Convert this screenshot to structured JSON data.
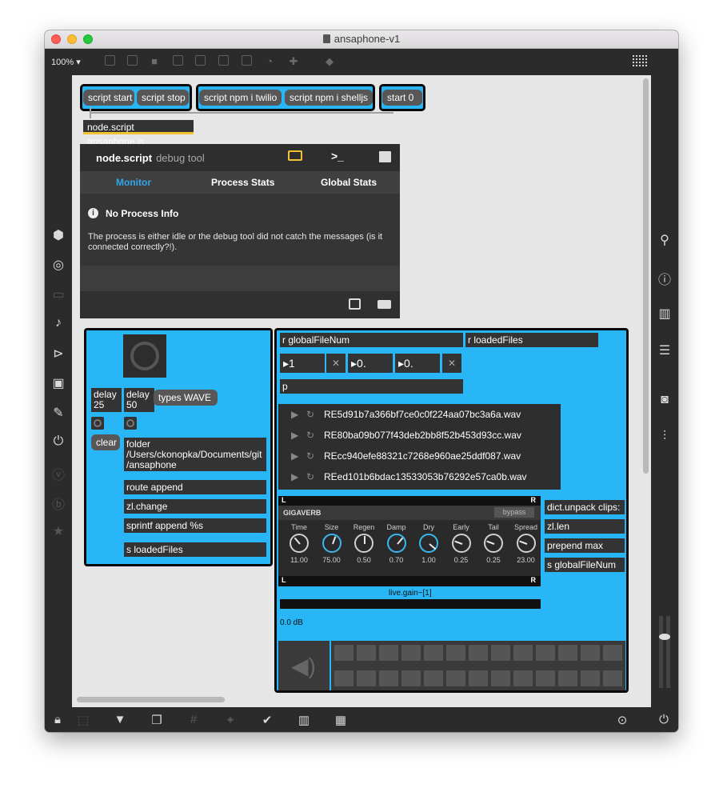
{
  "window": {
    "title": "ansaphone-v1"
  },
  "toolbar": {
    "zoom": "100%"
  },
  "buttons": {
    "script_start": "script start",
    "script_stop": "script stop",
    "npm_twilio": "script npm i twilio",
    "npm_shelljs": "script npm i shelljs",
    "start_0": "start 0"
  },
  "node_object": "node.script ansaphone.js",
  "debug_tool": {
    "title": "node.script",
    "subtitle": "debug tool",
    "tabs": [
      "Monitor",
      "Process Stats",
      "Global Stats"
    ],
    "active_tab": "Monitor",
    "info_title": "No Process Info",
    "info_text": "The process is either idle or the debug tool did not catch the messages (is it connected correctly?!)."
  },
  "left_group": {
    "delay_1": "delay 25",
    "delay_1a": "delay",
    "delay_1b": "25",
    "delay_2a": "delay",
    "delay_2b": "50",
    "types": "types WAVE",
    "clear": "clear",
    "folder": "folder /Users/ckonopka/Documents/git/ansaphone",
    "folder_l1": "folder",
    "folder_l2": "/Users/ckonopka/Documents/git",
    "folder_l3": "/ansaphone",
    "route": "route append",
    "zlchange": "zl.change",
    "sprintf": "sprintf append %s",
    "send": "s loadedFiles"
  },
  "right_group": {
    "r_global": "r globalFileNum",
    "r_loaded": "r loadedFiles",
    "num1": "1",
    "num2": "0.",
    "num3": "0.",
    "p": "p",
    "files": [
      "RE5d91b7a366bf7ce0c0f224aa07bc3a6a.wav",
      "RE80ba09b077f43deb2bb8f52b453d93cc.wav",
      "REcc940efe88321c7268e960ae25ddf087.wav",
      "REed101b6bdac13533053b76292e57ca0b.wav"
    ],
    "dict": "dict.unpack clips:",
    "zllen": "zl.len",
    "prepend": "prepend max",
    "s_global": "s globalFileNum",
    "meter_L": "L",
    "meter_R": "R",
    "gain_label": "live.gain~[1]",
    "gain_value": "0.0 dB"
  },
  "gigaverb": {
    "name": "GIGAVERB",
    "bypass": "bypass",
    "params": [
      {
        "label": "Time",
        "value": "11.00"
      },
      {
        "label": "Size",
        "value": "75.00"
      },
      {
        "label": "Regen",
        "value": "0.50"
      },
      {
        "label": "Damp",
        "value": "0.70"
      },
      {
        "label": "Dry",
        "value": "1.00"
      },
      {
        "label": "Early",
        "value": "0.25"
      },
      {
        "label": "Tail",
        "value": "0.25"
      },
      {
        "label": "Spread",
        "value": "23.00"
      }
    ]
  },
  "colors": {
    "group_bg": "#29b6f6",
    "object_bg": "#333333",
    "canvas_bg": "#e6e6e6",
    "accent_yellow": "#f2c230",
    "tab_active": "#2fa6e8"
  }
}
